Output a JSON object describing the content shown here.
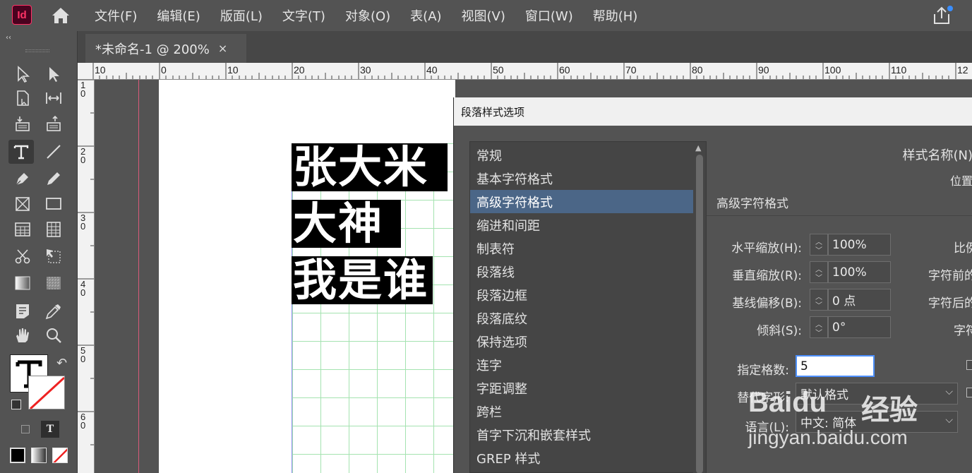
{
  "app": {
    "logo_text": "Id",
    "menu": [
      "文件(F)",
      "编辑(E)",
      "版面(L)",
      "文字(T)",
      "对象(O)",
      "表(A)",
      "视图(V)",
      "窗口(W)",
      "帮助(H)"
    ]
  },
  "tab": {
    "title": "*未命名-1 @ 200%",
    "close": "×"
  },
  "toolpanel": {
    "collapse": "‹‹"
  },
  "ruler": {
    "top": [
      "10",
      "0",
      "10",
      "20",
      "30",
      "40",
      "50",
      "60",
      "70",
      "80",
      "90",
      "100",
      "110",
      "12"
    ],
    "left": [
      "1\n0",
      "2\n0",
      "3\n0",
      "4\n0",
      "5\n0",
      "6\n0"
    ]
  },
  "document": {
    "lines": [
      "张大米",
      "大神",
      "我是谁"
    ]
  },
  "dialog": {
    "title": "段落样式选项",
    "categories": [
      "常规",
      "基本字符格式",
      "高级字符格式",
      "缩进和间距",
      "制表符",
      "段落线",
      "段落边框",
      "段落底纹",
      "保持选项",
      "连字",
      "字距调整",
      "跨栏",
      "首字下沉和嵌套样式",
      "GREP 样式"
    ],
    "selected_category": "高级字符格式",
    "style_name_label": "样式名称(N)",
    "position_label": "位置",
    "section_title": "高级字符格式",
    "fields": {
      "h_scale": {
        "label": "水平缩放(H):",
        "value": "100%"
      },
      "v_scale": {
        "label": "垂直缩放(R):",
        "value": "100%"
      },
      "baseline": {
        "label": "基线偏移(B):",
        "value": "0 点"
      },
      "skew": {
        "label": "倾斜(S):",
        "value": "0°"
      },
      "grid_count": {
        "label": "指定格数:",
        "value": "5"
      },
      "alt_glyph": {
        "label": "替代字形:",
        "value": "默认格式"
      },
      "language": {
        "label": "语言(L):",
        "value": "中文: 简体"
      }
    },
    "right_cut_labels": [
      "比例",
      "字符前的",
      "字符后的",
      "字符"
    ]
  },
  "watermark": {
    "brand": "Baidu",
    "product": "经验",
    "url": "jingyan.baidu.com"
  }
}
